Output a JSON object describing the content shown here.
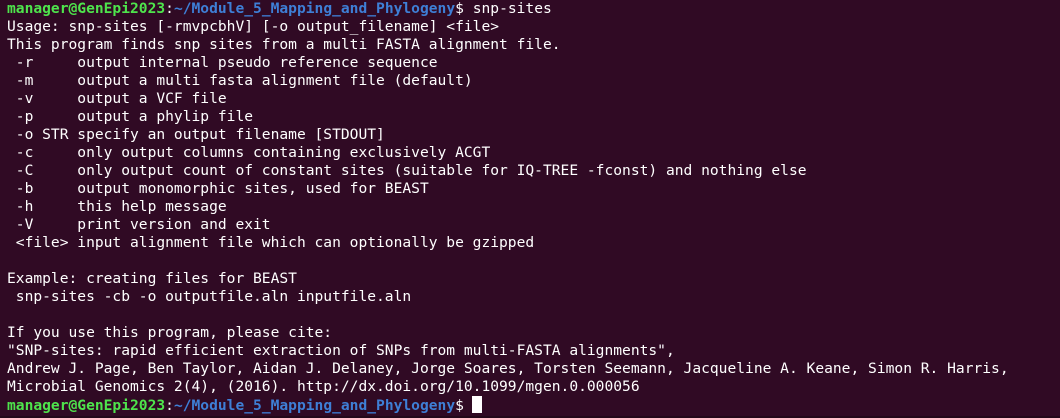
{
  "prompt": {
    "user_host": "manager@GenEpi2023",
    "separator": ":",
    "path": "~/Module_5_Mapping_and_Phylogeny",
    "symbol": "$"
  },
  "command": " snp-sites",
  "output_lines": [
    "Usage: snp-sites [-rmvpcbhV] [-o output_filename] <file>",
    "This program finds snp sites from a multi FASTA alignment file.",
    " -r     output internal pseudo reference sequence",
    " -m     output a multi fasta alignment file (default)",
    " -v     output a VCF file",
    " -p     output a phylip file",
    " -o STR specify an output filename [STDOUT]",
    " -c     only output columns containing exclusively ACGT",
    " -C     only output count of constant sites (suitable for IQ-TREE -fconst) and nothing else",
    " -b     output monomorphic sites, used for BEAST",
    " -h     this help message",
    " -V     print version and exit",
    " <file> input alignment file which can optionally be gzipped",
    "",
    "Example: creating files for BEAST",
    " snp-sites -cb -o outputfile.aln inputfile.aln",
    "",
    "If you use this program, please cite:",
    "\"SNP-sites: rapid efficient extraction of SNPs from multi-FASTA alignments\",",
    "Andrew J. Page, Ben Taylor, Aidan J. Delaney, Jorge Soares, Torsten Seemann, Jacqueline A. Keane, Simon R. Harris,",
    "Microbial Genomics 2(4), (2016). http://dx.doi.org/10.1099/mgen.0.000056"
  ],
  "colors": {
    "background": "#300a24",
    "user_host": "#4ee44c",
    "path": "#3e7fd6",
    "text": "#ffffff"
  }
}
